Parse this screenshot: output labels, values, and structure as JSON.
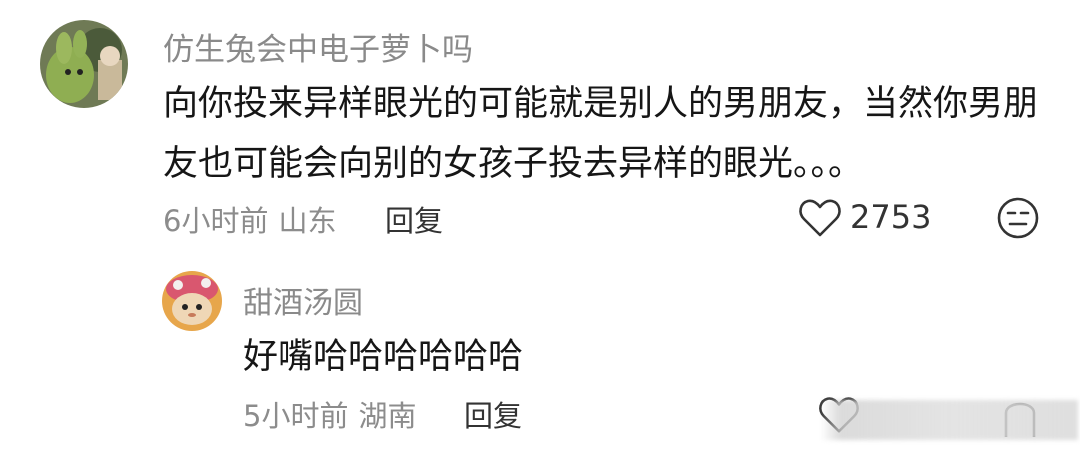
{
  "comment": {
    "username": "仿生兔会中电子萝卜吗",
    "text": "向你投来异样眼光的可能就是别人的男朋友，当然你男朋友也可能会向别的女孩子投去异样的眼光。。。",
    "time": "6小时前",
    "location": "山东",
    "reply_label": "回复",
    "like_count": "2753",
    "icons": {
      "like": "heart-icon",
      "dislike": "dislike-face-icon"
    }
  },
  "reply": {
    "username": "甜酒汤圆",
    "text": "好嘴哈哈哈哈哈哈",
    "time": "5小时前",
    "location": "湖南",
    "reply_label": "回复",
    "icons": {
      "like": "heart-icon",
      "dislike": "dislike-face-icon"
    }
  }
}
